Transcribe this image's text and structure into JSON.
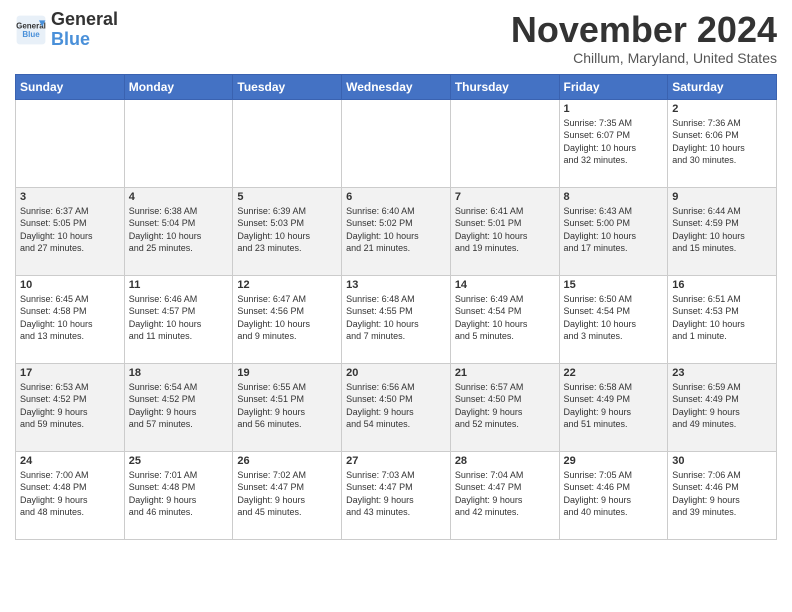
{
  "logo": {
    "line1": "General",
    "line2": "Blue"
  },
  "title": "November 2024",
  "subtitle": "Chillum, Maryland, United States",
  "days_of_week": [
    "Sunday",
    "Monday",
    "Tuesday",
    "Wednesday",
    "Thursday",
    "Friday",
    "Saturday"
  ],
  "weeks": [
    [
      {
        "day": "",
        "info": ""
      },
      {
        "day": "",
        "info": ""
      },
      {
        "day": "",
        "info": ""
      },
      {
        "day": "",
        "info": ""
      },
      {
        "day": "",
        "info": ""
      },
      {
        "day": "1",
        "info": "Sunrise: 7:35 AM\nSunset: 6:07 PM\nDaylight: 10 hours\nand 32 minutes."
      },
      {
        "day": "2",
        "info": "Sunrise: 7:36 AM\nSunset: 6:06 PM\nDaylight: 10 hours\nand 30 minutes."
      }
    ],
    [
      {
        "day": "3",
        "info": "Sunrise: 6:37 AM\nSunset: 5:05 PM\nDaylight: 10 hours\nand 27 minutes."
      },
      {
        "day": "4",
        "info": "Sunrise: 6:38 AM\nSunset: 5:04 PM\nDaylight: 10 hours\nand 25 minutes."
      },
      {
        "day": "5",
        "info": "Sunrise: 6:39 AM\nSunset: 5:03 PM\nDaylight: 10 hours\nand 23 minutes."
      },
      {
        "day": "6",
        "info": "Sunrise: 6:40 AM\nSunset: 5:02 PM\nDaylight: 10 hours\nand 21 minutes."
      },
      {
        "day": "7",
        "info": "Sunrise: 6:41 AM\nSunset: 5:01 PM\nDaylight: 10 hours\nand 19 minutes."
      },
      {
        "day": "8",
        "info": "Sunrise: 6:43 AM\nSunset: 5:00 PM\nDaylight: 10 hours\nand 17 minutes."
      },
      {
        "day": "9",
        "info": "Sunrise: 6:44 AM\nSunset: 4:59 PM\nDaylight: 10 hours\nand 15 minutes."
      }
    ],
    [
      {
        "day": "10",
        "info": "Sunrise: 6:45 AM\nSunset: 4:58 PM\nDaylight: 10 hours\nand 13 minutes."
      },
      {
        "day": "11",
        "info": "Sunrise: 6:46 AM\nSunset: 4:57 PM\nDaylight: 10 hours\nand 11 minutes."
      },
      {
        "day": "12",
        "info": "Sunrise: 6:47 AM\nSunset: 4:56 PM\nDaylight: 10 hours\nand 9 minutes."
      },
      {
        "day": "13",
        "info": "Sunrise: 6:48 AM\nSunset: 4:55 PM\nDaylight: 10 hours\nand 7 minutes."
      },
      {
        "day": "14",
        "info": "Sunrise: 6:49 AM\nSunset: 4:54 PM\nDaylight: 10 hours\nand 5 minutes."
      },
      {
        "day": "15",
        "info": "Sunrise: 6:50 AM\nSunset: 4:54 PM\nDaylight: 10 hours\nand 3 minutes."
      },
      {
        "day": "16",
        "info": "Sunrise: 6:51 AM\nSunset: 4:53 PM\nDaylight: 10 hours\nand 1 minute."
      }
    ],
    [
      {
        "day": "17",
        "info": "Sunrise: 6:53 AM\nSunset: 4:52 PM\nDaylight: 9 hours\nand 59 minutes."
      },
      {
        "day": "18",
        "info": "Sunrise: 6:54 AM\nSunset: 4:52 PM\nDaylight: 9 hours\nand 57 minutes."
      },
      {
        "day": "19",
        "info": "Sunrise: 6:55 AM\nSunset: 4:51 PM\nDaylight: 9 hours\nand 56 minutes."
      },
      {
        "day": "20",
        "info": "Sunrise: 6:56 AM\nSunset: 4:50 PM\nDaylight: 9 hours\nand 54 minutes."
      },
      {
        "day": "21",
        "info": "Sunrise: 6:57 AM\nSunset: 4:50 PM\nDaylight: 9 hours\nand 52 minutes."
      },
      {
        "day": "22",
        "info": "Sunrise: 6:58 AM\nSunset: 4:49 PM\nDaylight: 9 hours\nand 51 minutes."
      },
      {
        "day": "23",
        "info": "Sunrise: 6:59 AM\nSunset: 4:49 PM\nDaylight: 9 hours\nand 49 minutes."
      }
    ],
    [
      {
        "day": "24",
        "info": "Sunrise: 7:00 AM\nSunset: 4:48 PM\nDaylight: 9 hours\nand 48 minutes."
      },
      {
        "day": "25",
        "info": "Sunrise: 7:01 AM\nSunset: 4:48 PM\nDaylight: 9 hours\nand 46 minutes."
      },
      {
        "day": "26",
        "info": "Sunrise: 7:02 AM\nSunset: 4:47 PM\nDaylight: 9 hours\nand 45 minutes."
      },
      {
        "day": "27",
        "info": "Sunrise: 7:03 AM\nSunset: 4:47 PM\nDaylight: 9 hours\nand 43 minutes."
      },
      {
        "day": "28",
        "info": "Sunrise: 7:04 AM\nSunset: 4:47 PM\nDaylight: 9 hours\nand 42 minutes."
      },
      {
        "day": "29",
        "info": "Sunrise: 7:05 AM\nSunset: 4:46 PM\nDaylight: 9 hours\nand 40 minutes."
      },
      {
        "day": "30",
        "info": "Sunrise: 7:06 AM\nSunset: 4:46 PM\nDaylight: 9 hours\nand 39 minutes."
      }
    ]
  ]
}
